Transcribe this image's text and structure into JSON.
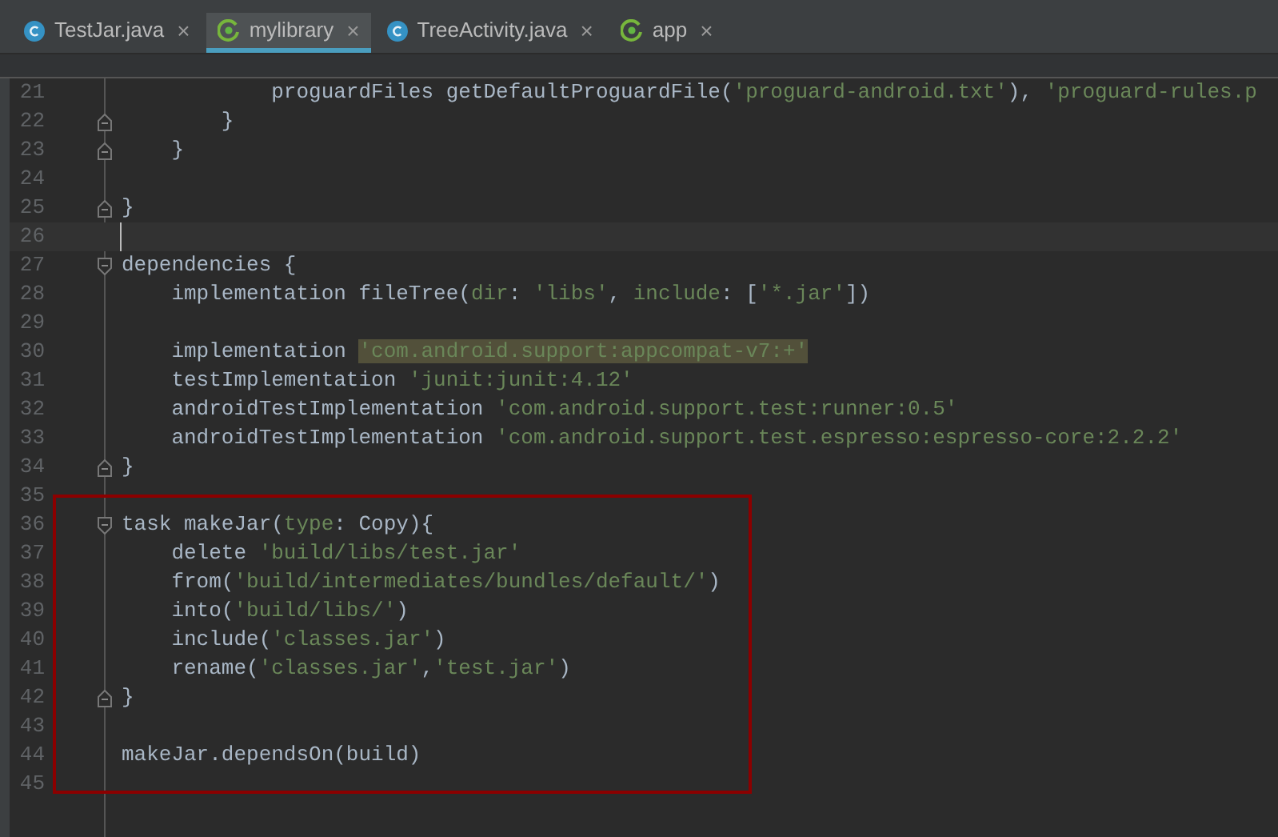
{
  "tabs": [
    {
      "label": "TestJar.java",
      "kind": "class",
      "selected": false,
      "close": "×"
    },
    {
      "label": "mylibrary",
      "kind": "gradle",
      "selected": true,
      "close": "×"
    },
    {
      "label": "TreeActivity.java",
      "kind": "class",
      "selected": false,
      "close": "×"
    },
    {
      "label": "app",
      "kind": "gradle",
      "selected": false,
      "close": "×"
    }
  ],
  "editor": {
    "lines": [
      {
        "number": "21",
        "segments": [
          {
            "kind": "plain",
            "text": "            proguardFiles getDefaultProguardFile("
          },
          {
            "kind": "string",
            "text": "'proguard-android.txt'"
          },
          {
            "kind": "plain",
            "text": "), "
          },
          {
            "kind": "string",
            "text": "'proguard-rules.p"
          }
        ]
      },
      {
        "number": "22",
        "kind": "fold_end",
        "segments": [
          {
            "kind": "plain",
            "text": "        }"
          }
        ]
      },
      {
        "number": "23",
        "kind": "fold_end",
        "segments": [
          {
            "kind": "plain",
            "text": "    }"
          }
        ]
      },
      {
        "number": "24"
      },
      {
        "number": "25",
        "kind": "fold_end",
        "segments": [
          {
            "kind": "plain",
            "text": "}"
          }
        ]
      },
      {
        "number": "26",
        "caret": true
      },
      {
        "number": "27",
        "kind": "fold_start",
        "segments": [
          {
            "kind": "plain",
            "text": "dependencies {"
          }
        ]
      },
      {
        "number": "28",
        "segments": [
          {
            "kind": "plain",
            "text": "    implementation fileTree("
          },
          {
            "kind": "named",
            "text": "dir"
          },
          {
            "kind": "plain",
            "text": ": "
          },
          {
            "kind": "string",
            "text": "'libs'"
          },
          {
            "kind": "plain",
            "text": ", "
          },
          {
            "kind": "named",
            "text": "include"
          },
          {
            "kind": "plain",
            "text": ": ["
          },
          {
            "kind": "string",
            "text": "'*.jar'"
          },
          {
            "kind": "plain",
            "text": "])"
          }
        ]
      },
      {
        "number": "29"
      },
      {
        "number": "30",
        "segments": [
          {
            "kind": "plain",
            "text": "    implementation "
          },
          {
            "kind": "marked",
            "text": "'com.android.support:appcompat-v7:+'"
          }
        ]
      },
      {
        "number": "31",
        "segments": [
          {
            "kind": "plain",
            "text": "    testImplementation "
          },
          {
            "kind": "string",
            "text": "'junit:junit:4.12'"
          }
        ]
      },
      {
        "number": "32",
        "segments": [
          {
            "kind": "plain",
            "text": "    androidTestImplementation "
          },
          {
            "kind": "string",
            "text": "'com.android.support.test:runner:0.5'"
          }
        ]
      },
      {
        "number": "33",
        "segments": [
          {
            "kind": "plain",
            "text": "    androidTestImplementation "
          },
          {
            "kind": "string",
            "text": "'com.android.support.test.espresso:espresso-core:2.2.2'"
          }
        ]
      },
      {
        "number": "34",
        "kind": "fold_end",
        "segments": [
          {
            "kind": "plain",
            "text": "}"
          }
        ]
      },
      {
        "number": "35"
      },
      {
        "number": "36",
        "kind": "fold_start",
        "segments": [
          {
            "kind": "plain",
            "text": "task makeJar("
          },
          {
            "kind": "named",
            "text": "type"
          },
          {
            "kind": "plain",
            "text": ": Copy){"
          }
        ]
      },
      {
        "number": "37",
        "segments": [
          {
            "kind": "plain",
            "text": "    delete "
          },
          {
            "kind": "string",
            "text": "'build/libs/test.jar'"
          }
        ]
      },
      {
        "number": "38",
        "segments": [
          {
            "kind": "plain",
            "text": "    from("
          },
          {
            "kind": "string",
            "text": "'build/intermediates/bundles/default/'"
          },
          {
            "kind": "plain",
            "text": ")"
          }
        ]
      },
      {
        "number": "39",
        "segments": [
          {
            "kind": "plain",
            "text": "    into("
          },
          {
            "kind": "string",
            "text": "'build/libs/'"
          },
          {
            "kind": "plain",
            "text": ")"
          }
        ]
      },
      {
        "number": "40",
        "segments": [
          {
            "kind": "plain",
            "text": "    include("
          },
          {
            "kind": "string",
            "text": "'classes.jar'"
          },
          {
            "kind": "plain",
            "text": ")"
          }
        ]
      },
      {
        "number": "41",
        "segments": [
          {
            "kind": "plain",
            "text": "    rename("
          },
          {
            "kind": "string",
            "text": "'classes.jar'"
          },
          {
            "kind": "plain",
            "text": ","
          },
          {
            "kind": "string",
            "text": "'test.jar'"
          },
          {
            "kind": "plain",
            "text": ")"
          }
        ]
      },
      {
        "number": "42",
        "kind": "fold_end",
        "segments": [
          {
            "kind": "plain",
            "text": "}"
          }
        ]
      },
      {
        "number": "43"
      },
      {
        "number": "44",
        "segments": [
          {
            "kind": "plain",
            "text": "makeJar.dependsOn(build)"
          }
        ]
      },
      {
        "number": "45"
      }
    ]
  }
}
